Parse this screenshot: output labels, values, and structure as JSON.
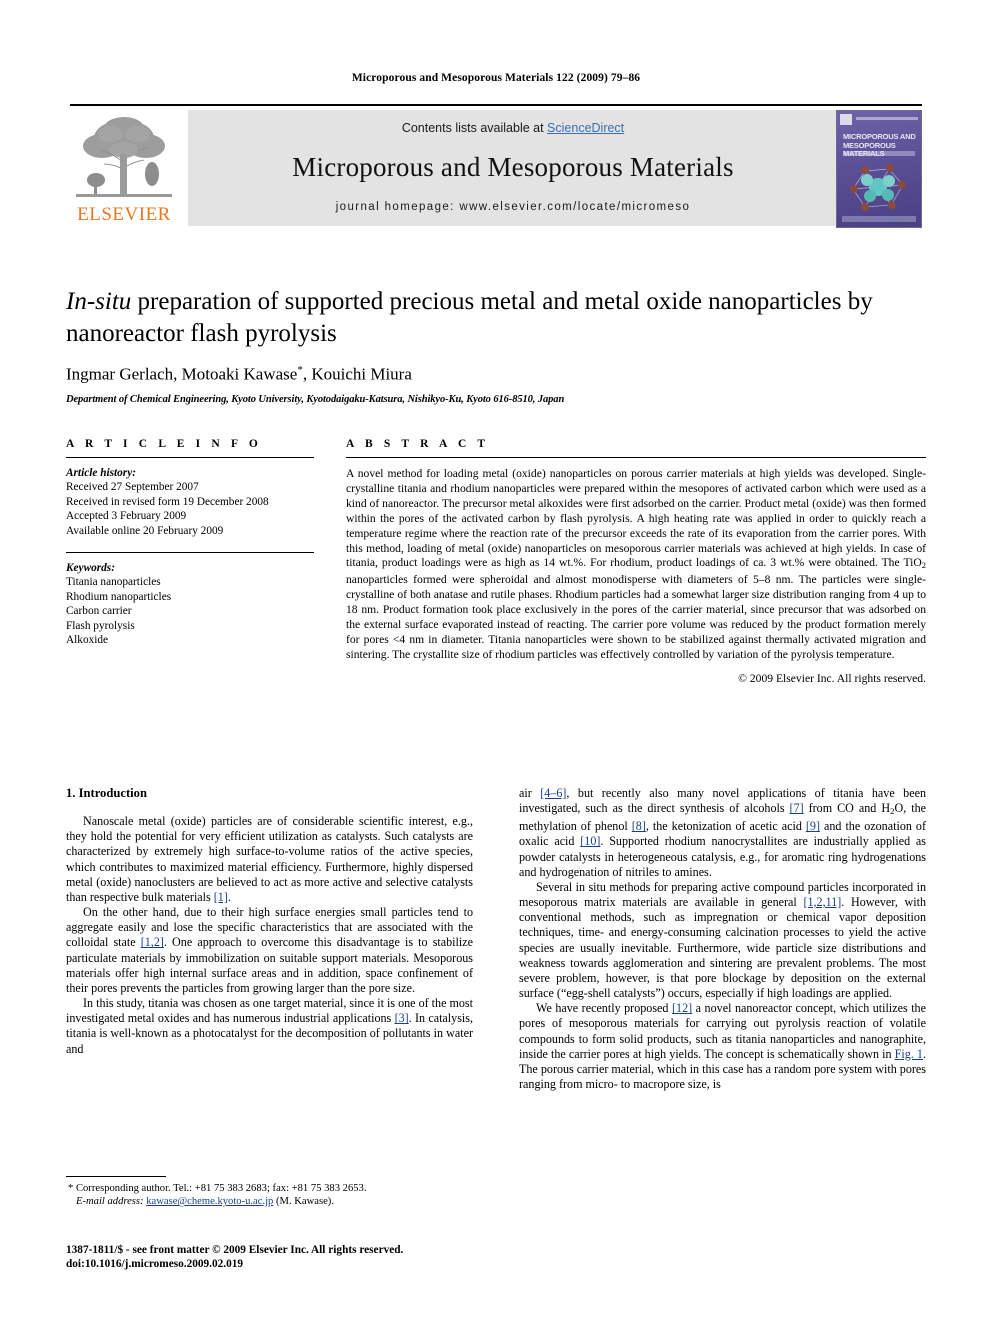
{
  "running_head": "Microporous and Mesoporous Materials 122 (2009) 79–86",
  "banner": {
    "contents_prefix": "Contents lists available at ",
    "sciencedirect": "ScienceDirect",
    "journal_title": "Microporous and Mesoporous Materials",
    "homepage": "journal homepage: www.elsevier.com/locate/micromeso",
    "publisher_logo_text": "ELSEVIER",
    "cover_title_line1": "MICROPOROUS AND",
    "cover_title_line2": "MESOPOROUS MATERIALS",
    "accent_link_color": "#3b6fb6",
    "elsevier_orange": "#E87722",
    "cover_purple": "#5b4f96"
  },
  "article": {
    "title_italic": "In-situ",
    "title_rest": " preparation of supported precious metal and metal oxide nanoparticles by nanoreactor flash pyrolysis",
    "authors": "Ingmar Gerlach, Motoaki Kawase",
    "corresponding_marker": "*",
    "authors_tail": ", Kouichi Miura",
    "affiliation": "Department of Chemical Engineering, Kyoto University, Kyotodaigaku-Katsura, Nishikyo-Ku, Kyoto 616-8510, Japan"
  },
  "article_info": {
    "heading": "A R T I C L E  I N F O",
    "history_label": "Article history:",
    "history": [
      "Received 27 September 2007",
      "Received in revised form 19 December 2008",
      "Accepted 3 February 2009",
      "Available online 20 February 2009"
    ],
    "keywords_label": "Keywords:",
    "keywords": [
      "Titania nanoparticles",
      "Rhodium nanoparticles",
      "Carbon carrier",
      "Flash pyrolysis",
      "Alkoxide"
    ]
  },
  "abstract": {
    "heading": "A B S T R A C T",
    "p1": "A novel method for loading metal (oxide) nanoparticles on porous carrier materials at high yields was developed. Single-crystalline titania and rhodium nanoparticles were prepared within the mesopores of activated carbon which were used as a kind of nanoreactor. The precursor metal alkoxides were first adsorbed on the carrier. Product metal (oxide) was then formed within the pores of the activated carbon by flash pyrolysis. A high heating rate was applied in order to quickly reach a temperature regime where the reaction rate of the precursor exceeds the rate of its evaporation from the carrier pores. With this method, loading of metal (oxide) nanoparticles on mesoporous carrier materials was achieved at high yields. In case of titania, product loadings were as high as 14 wt.%. For rhodium, product loadings of ca. 3 wt.% were obtained. The TiO",
    "p1_sub": "2",
    "p1_cont": " nanoparticles formed were spheroidal and almost monodisperse with diameters of 5–8 nm. The particles were single-crystalline of both anatase and rutile phases. Rhodium particles had a somewhat larger size distribution ranging from 4 up to 18 nm. Product formation took place exclusively in the pores of the carrier material, since precursor that was adsorbed on the external surface evaporated instead of reacting. The carrier pore volume was reduced by the product formation merely for pores <4 nm in diameter. Titania nanoparticles were shown to be stabilized against thermally activated migration and sintering. The crystallite size of rhodium particles was effectively controlled by variation of the pyrolysis temperature.",
    "copyright": "© 2009 Elsevier Inc. All rights reserved."
  },
  "body": {
    "section_title": "1. Introduction",
    "left": {
      "p1_a": "Nanoscale metal (oxide) particles are of considerable scientific interest, e.g., they hold the potential for very efficient utilization as catalysts. Such catalysts are characterized by extremely high surface-to-volume ratios of the active species, which contributes to maximized material efficiency. Furthermore, highly dispersed metal (oxide) nanoclusters are believed to act as more active and selective catalysts than respective bulk materials ",
      "p1_ref": "[1]",
      "p1_b": ".",
      "p2_a": "On the other hand, due to their high surface energies small particles tend to aggregate easily and lose the specific characteristics that are associated with the colloidal state ",
      "p2_ref": "[1,2]",
      "p2_b": ". One approach to overcome this disadvantage is to stabilize particulate materials by immobilization on suitable support materials. Mesoporous materials offer high internal surface areas and in addition, space confinement of their pores prevents the particles from growing larger than the pore size.",
      "p3_a": "In this study, titania was chosen as one target material, since it is one of the most investigated metal oxides and has numerous industrial applications ",
      "p3_ref": "[3]",
      "p3_b": ". In catalysis, titania is well-known as a photocatalyst for the decomposition of pollutants in water and"
    },
    "right": {
      "p3c_a": "air ",
      "p3c_ref1": "[4–6]",
      "p3c_b": ", but recently also many novel applications of titania have been investigated, such as the direct synthesis of alcohols ",
      "p3c_ref2": "[7]",
      "p3c_c": " from CO and H",
      "p3c_sub": "2",
      "p3c_d": "O, the methylation of phenol ",
      "p3c_ref3": "[8]",
      "p3c_e": ", the ketonization of acetic acid ",
      "p3c_ref4": "[9]",
      "p3c_f": " and the ozonation of oxalic acid ",
      "p3c_ref5": "[10]",
      "p3c_g": ". Supported rhodium nanocrystallites are industrially applied as powder catalysts in heterogeneous catalysis, e.g., for aromatic ring hydrogenations and hydrogenation of nitriles to amines.",
      "p4_a": "Several in situ methods for preparing active compound particles incorporated in mesoporous matrix materials are available in general ",
      "p4_ref": "[1,2,11]",
      "p4_b": ". However, with conventional methods, such as impregnation or chemical vapor deposition techniques, time- and energy-consuming calcination processes to yield the active species are usually inevitable. Furthermore, wide particle size distributions and weakness towards agglomeration and sintering are prevalent problems. The most severe problem, however, is that pore blockage by deposition on the external surface (“egg-shell catalysts”) occurs, especially if high loadings are applied.",
      "p5_a": "We have recently proposed ",
      "p5_ref": "[12]",
      "p5_b": " a novel nanoreactor concept, which utilizes the pores of mesoporous materials for carrying out pyrolysis reaction of volatile compounds to form solid products, such as titania nanoparticles and nanographite, inside the carrier pores at high yields. The concept is schematically shown in ",
      "p5_figref": "Fig. 1",
      "p5_c": ". The porous carrier material, which in this case has a random pore system with pores ranging from micro- to macropore size, is"
    }
  },
  "footnote": {
    "marker": "*",
    "corresponding": " Corresponding author. Tel.: +81 75 383 2683; fax: +81 75 383 2653.",
    "email_label": "E-mail address:",
    "email": "kawase@cheme.kyoto-u.ac.jp",
    "email_owner": "(M. Kawase).",
    "imprint_line1": "1387-1811/$ - see front matter © 2009 Elsevier Inc. All rights reserved.",
    "imprint_line2": "doi:10.1016/j.micromeso.2009.02.019"
  }
}
